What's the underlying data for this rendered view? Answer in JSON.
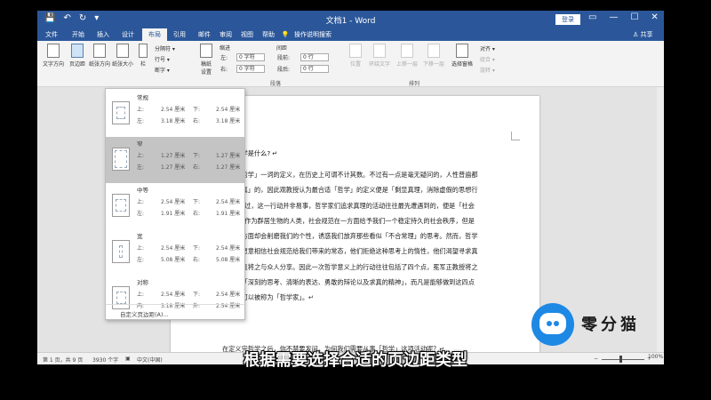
{
  "titlebar": {
    "doc_title": "文档1 - Word",
    "login": "登录",
    "qat": [
      "💾",
      "↶",
      "↻",
      "▾"
    ],
    "ctrls": [
      "▭",
      "—",
      "☐",
      "✕"
    ]
  },
  "tabs": [
    "文件",
    "开始",
    "插入",
    "设计",
    "布局",
    "引用",
    "邮件",
    "审阅",
    "视图",
    "帮助",
    "💡",
    "操作说明搜索"
  ],
  "active_tab_index": 4,
  "share": "♙ 共享",
  "ribbon": {
    "wenzi_fangxiang": "文字方向",
    "yebianju": "页边距",
    "zhizhang_fangxiang": "纸张方向",
    "zhizhang_daxiao": "纸张大小",
    "lan": "栏",
    "fengefu": "分隔符 ▾",
    "hanghao": "行号 ▾",
    "duanzi": "断字 ▾",
    "gaozhi_1": "稿纸",
    "gaozhi_2": "设置",
    "gaozhi_group": "稿纸",
    "suojin": "缩进",
    "jianju": "间距",
    "zuo": "左:",
    "you": "右:",
    "duanqian": "段前:",
    "duanhou": "段后:",
    "v_zuo": "0 字符",
    "v_you": "0 字符",
    "v_duanqian": "0 行",
    "v_duanhou": "0 行",
    "duanluo_group": "段落",
    "arrange": [
      "位置",
      "环绕文字",
      "上移一层",
      "下移一层",
      "选择窗格"
    ],
    "duiqi": "对齐 ▾",
    "zuhe": "组合 ▾",
    "xuanzhuan": "旋转 ▾",
    "pailie_group": "排列"
  },
  "dropdown": {
    "options": [
      {
        "name": "常规",
        "l1": "上:",
        "v1": "2.54 厘米",
        "l2": "下:",
        "v2": "2.54 厘米",
        "l3": "左:",
        "v3": "3.18 厘米",
        "l4": "右:",
        "v4": "3.18 厘米"
      },
      {
        "name": "窄",
        "l1": "上:",
        "v1": "1.27 厘米",
        "l2": "下:",
        "v2": "1.27 厘米",
        "l3": "左:",
        "v3": "1.27 厘米",
        "l4": "右:",
        "v4": "1.27 厘米"
      },
      {
        "name": "中等",
        "l1": "上:",
        "v1": "2.54 厘米",
        "l2": "下:",
        "v2": "2.54 厘米",
        "l3": "左:",
        "v3": "1.91 厘米",
        "l4": "右:",
        "v4": "1.91 厘米"
      },
      {
        "name": "宽",
        "l1": "上:",
        "v1": "2.54 厘米",
        "l2": "下:",
        "v2": "2.54 厘米",
        "l3": "左:",
        "v3": "5.08 厘米",
        "l4": "右:",
        "v4": "5.08 厘米"
      },
      {
        "name": "对称",
        "l1": "上:",
        "v1": "2.54 厘米",
        "l2": "下:",
        "v2": "2.54 厘米",
        "l3": "内:",
        "v3": "3.18 厘米",
        "l4": "外:",
        "v4": "2.54 厘米"
      }
    ],
    "hover_index": 1,
    "custom": "自定义页边距(A)..."
  },
  "document": {
    "heading": "一、哲学是什么? ↵",
    "lines": [
      "关于「哲学」一词的定义，在历史上可谓不计其数。不过有一点是毫无疑问的，人性普遍都",
      "是「求真」的，因此观教授认为最合适「哲学」的定义便是「剩显真理，消除虚假的思想行",
      "动」。不过，这一行动并非易事，哲学家们追求真理的活动往往最先遭遇到的，便是「社会",
      "规范」。作为群居生物的人类，社会规范在一方面给予我们一个稳定持久的社会秩序，但是",
      "在另一方面却会削磨我们的个性，诱惑我们放弃那些看似「不合常理」的思考。然而，哲学",
      "家却不愿意相信社会规范给我们带来的常态，他们拒绝这种思考上的惰性，他们渴望寻求真",
      "理，并且将之与众人分享。因此一次哲学意义上的行动往往包括了四个点，冕军正教授将之",
      "总结为「深刻的思考、清晰的表达、勇敢的辩论以及求真的精神」，而凡是能够做到这四点",
      "的人都可以被称为「哲学家」。↵"
    ],
    "last_line": "在定义完哲学之后，你不禁要发问，为何我们需要从事「哲学」这项活动呢？↵"
  },
  "status": {
    "page": "第 1 页，共 9 页",
    "words": "3930 个字",
    "proof": "▣",
    "lang": "中文(中国)",
    "zoom": "100%",
    "minus": "−",
    "plus": "+"
  },
  "logo": {
    "text": "零分猫"
  },
  "subtitle": "根据需要选择合适的页边距类型"
}
